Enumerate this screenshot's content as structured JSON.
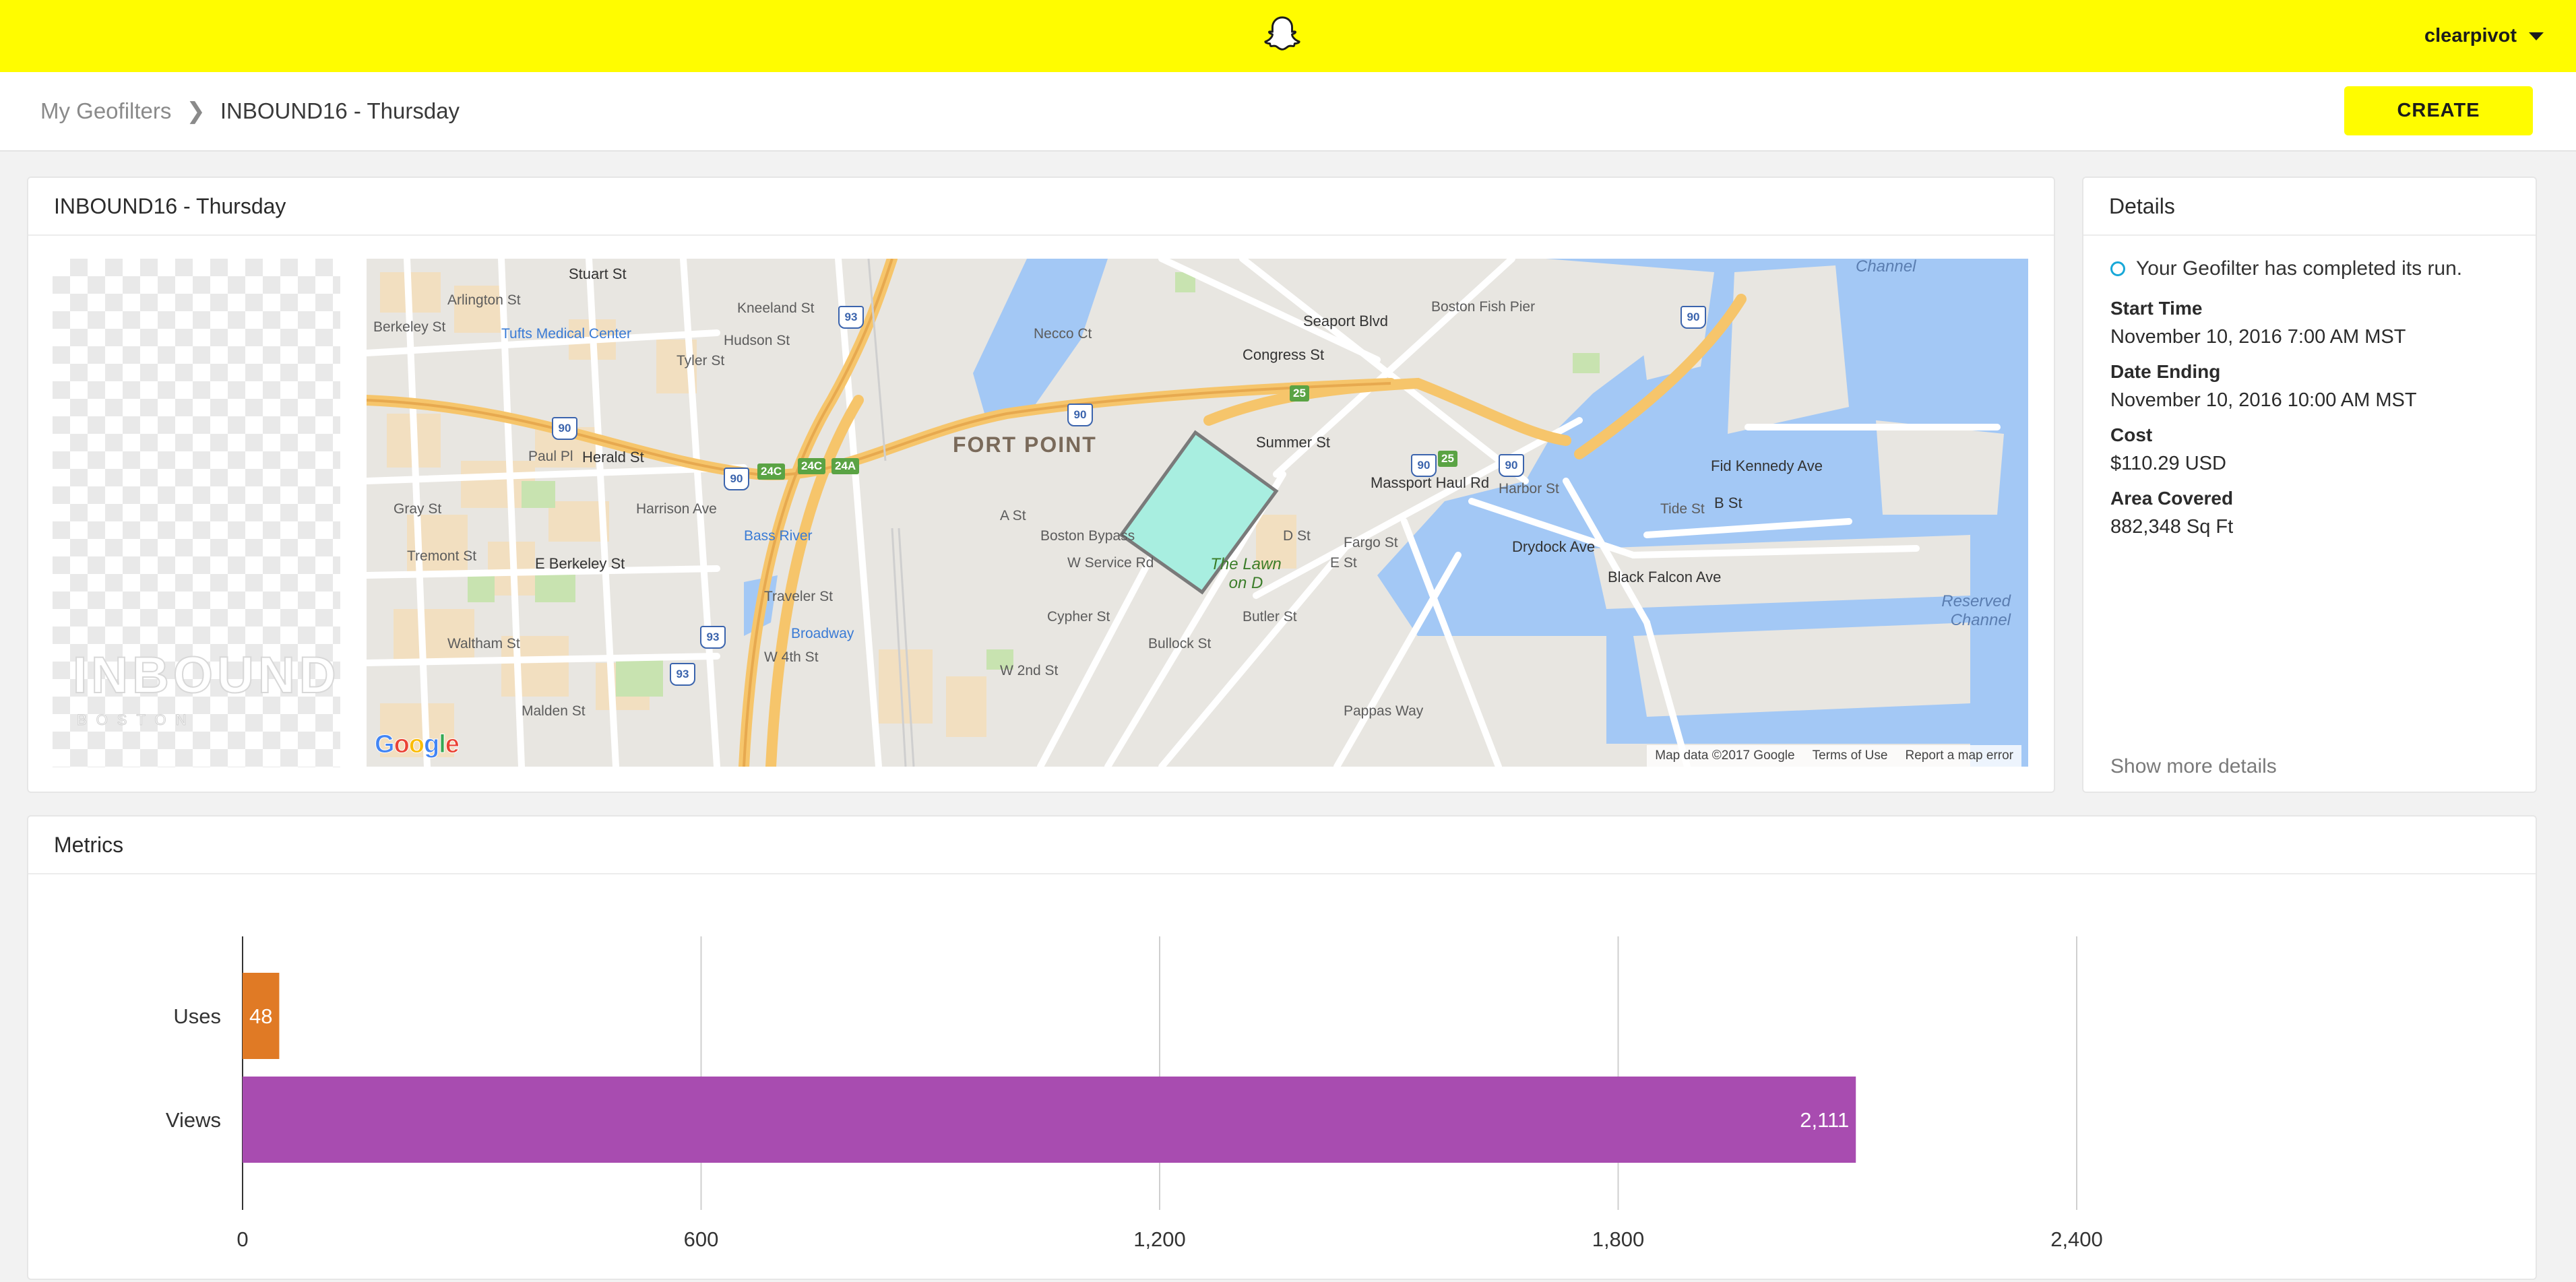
{
  "header": {
    "logo_icon": "snapchat-ghost-icon",
    "username": "clearpivot",
    "brand_color": "#fffc00"
  },
  "breadcrumb": {
    "root": "My Geofilters",
    "separator": "❯",
    "current": "INBOUND16 - Thursday"
  },
  "toolbar": {
    "create_label": "CREATE"
  },
  "main_card": {
    "title": "INBOUND16 - Thursday",
    "thumbnail": {
      "title": "INBOUND",
      "subtitle": "BOSTON"
    },
    "map": {
      "district": "FORT POINT",
      "streets": [
        "Stuart St",
        "Tufts Medical Center",
        "Kneeland St",
        "Herald St",
        "Paul Pl",
        "Gray St",
        "Tremont St",
        "E Berkeley St",
        "Harrison Ave",
        "Traveler St",
        "Broadway",
        "W 4th St",
        "Waltham St",
        "Malden St",
        "Arlington St",
        "Berkeley St",
        "Hudson St",
        "Tyler St",
        "Necco Ct",
        "Congress St",
        "Seaport Blvd",
        "Summer St",
        "A St",
        "Boston Bypass",
        "W Service Rd",
        "Cypher St",
        "W 2nd St",
        "Bullock St",
        "D St",
        "E St",
        "Fargo St",
        "Butler St",
        "Pappas Way",
        "Massport Haul Rd",
        "Drydock Ave",
        "Harbor St",
        "Black Falcon Ave",
        "Fid Kennedy Ave",
        "B St",
        "Tide St",
        "Boston Fish Pier",
        "Bass River",
        "Reserved Channel",
        "Channel",
        "The Lawn on D"
      ],
      "routes": [
        "93",
        "90",
        "24C",
        "24A",
        "25"
      ],
      "attribution": "Map data ©2017 Google",
      "terms": "Terms of Use",
      "report": "Report a map error",
      "logo": "Google",
      "geofence_color": "#a8eee0"
    }
  },
  "details": {
    "title": "Details",
    "status": "Your Geofilter has completed its run.",
    "status_color": "#18a8d8",
    "start_label": "Start Time",
    "start_value": "November 10, 2016 7:00 AM  MST",
    "end_label": "Date Ending",
    "end_value": "November 10, 2016 10:00 AM  MST",
    "cost_label": "Cost",
    "cost_value": "$110.29 USD",
    "area_label": "Area Covered",
    "area_value": "882,348 Sq Ft",
    "show_more": "Show more details"
  },
  "metrics": {
    "title": "Metrics",
    "chart_data": {
      "type": "bar",
      "orientation": "horizontal",
      "categories": [
        "Uses",
        "Views"
      ],
      "values": [
        48,
        2111
      ],
      "value_labels": [
        "48",
        "2,111"
      ],
      "colors": [
        "#e07a25",
        "#a84cb0"
      ],
      "xlim": [
        0,
        2400
      ],
      "xticks": [
        0,
        600,
        1200,
        1800,
        2400
      ],
      "xtick_labels": [
        "0",
        "600",
        "1,200",
        "1,800",
        "2,400"
      ],
      "grid": true,
      "legend": "none"
    }
  }
}
